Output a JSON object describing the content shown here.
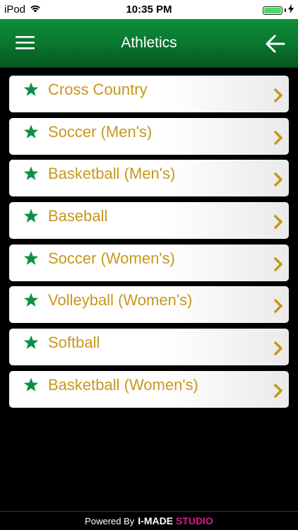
{
  "status_bar": {
    "carrier": "iPod",
    "time": "10:35 PM"
  },
  "nav": {
    "title": "Athletics"
  },
  "items": [
    {
      "label": "Cross Country"
    },
    {
      "label": "Soccer (Men's)"
    },
    {
      "label": "Basketball (Men's)"
    },
    {
      "label": "Baseball"
    },
    {
      "label": "Soccer (Women's)"
    },
    {
      "label": "Volleyball (Women's)"
    },
    {
      "label": "Softball"
    },
    {
      "label": "Basketball (Women's)"
    }
  ],
  "footer": {
    "powered_by": "Powered By",
    "brand_main": "I-MADE",
    "brand_accent": "STUDIO"
  },
  "colors": {
    "nav_green": "#0a7a30",
    "star_green": "#0e8f46",
    "label_gold": "#c9971c",
    "brand_pink": "#e0188c"
  },
  "icons": {
    "menu": "hamburger-menu-icon",
    "back": "arrow-left-icon",
    "item_marker": "star-icon",
    "item_disclosure": "chevron-right-icon",
    "wifi": "wifi-icon",
    "battery": "battery-icon",
    "charging": "charging-bolt-icon"
  }
}
